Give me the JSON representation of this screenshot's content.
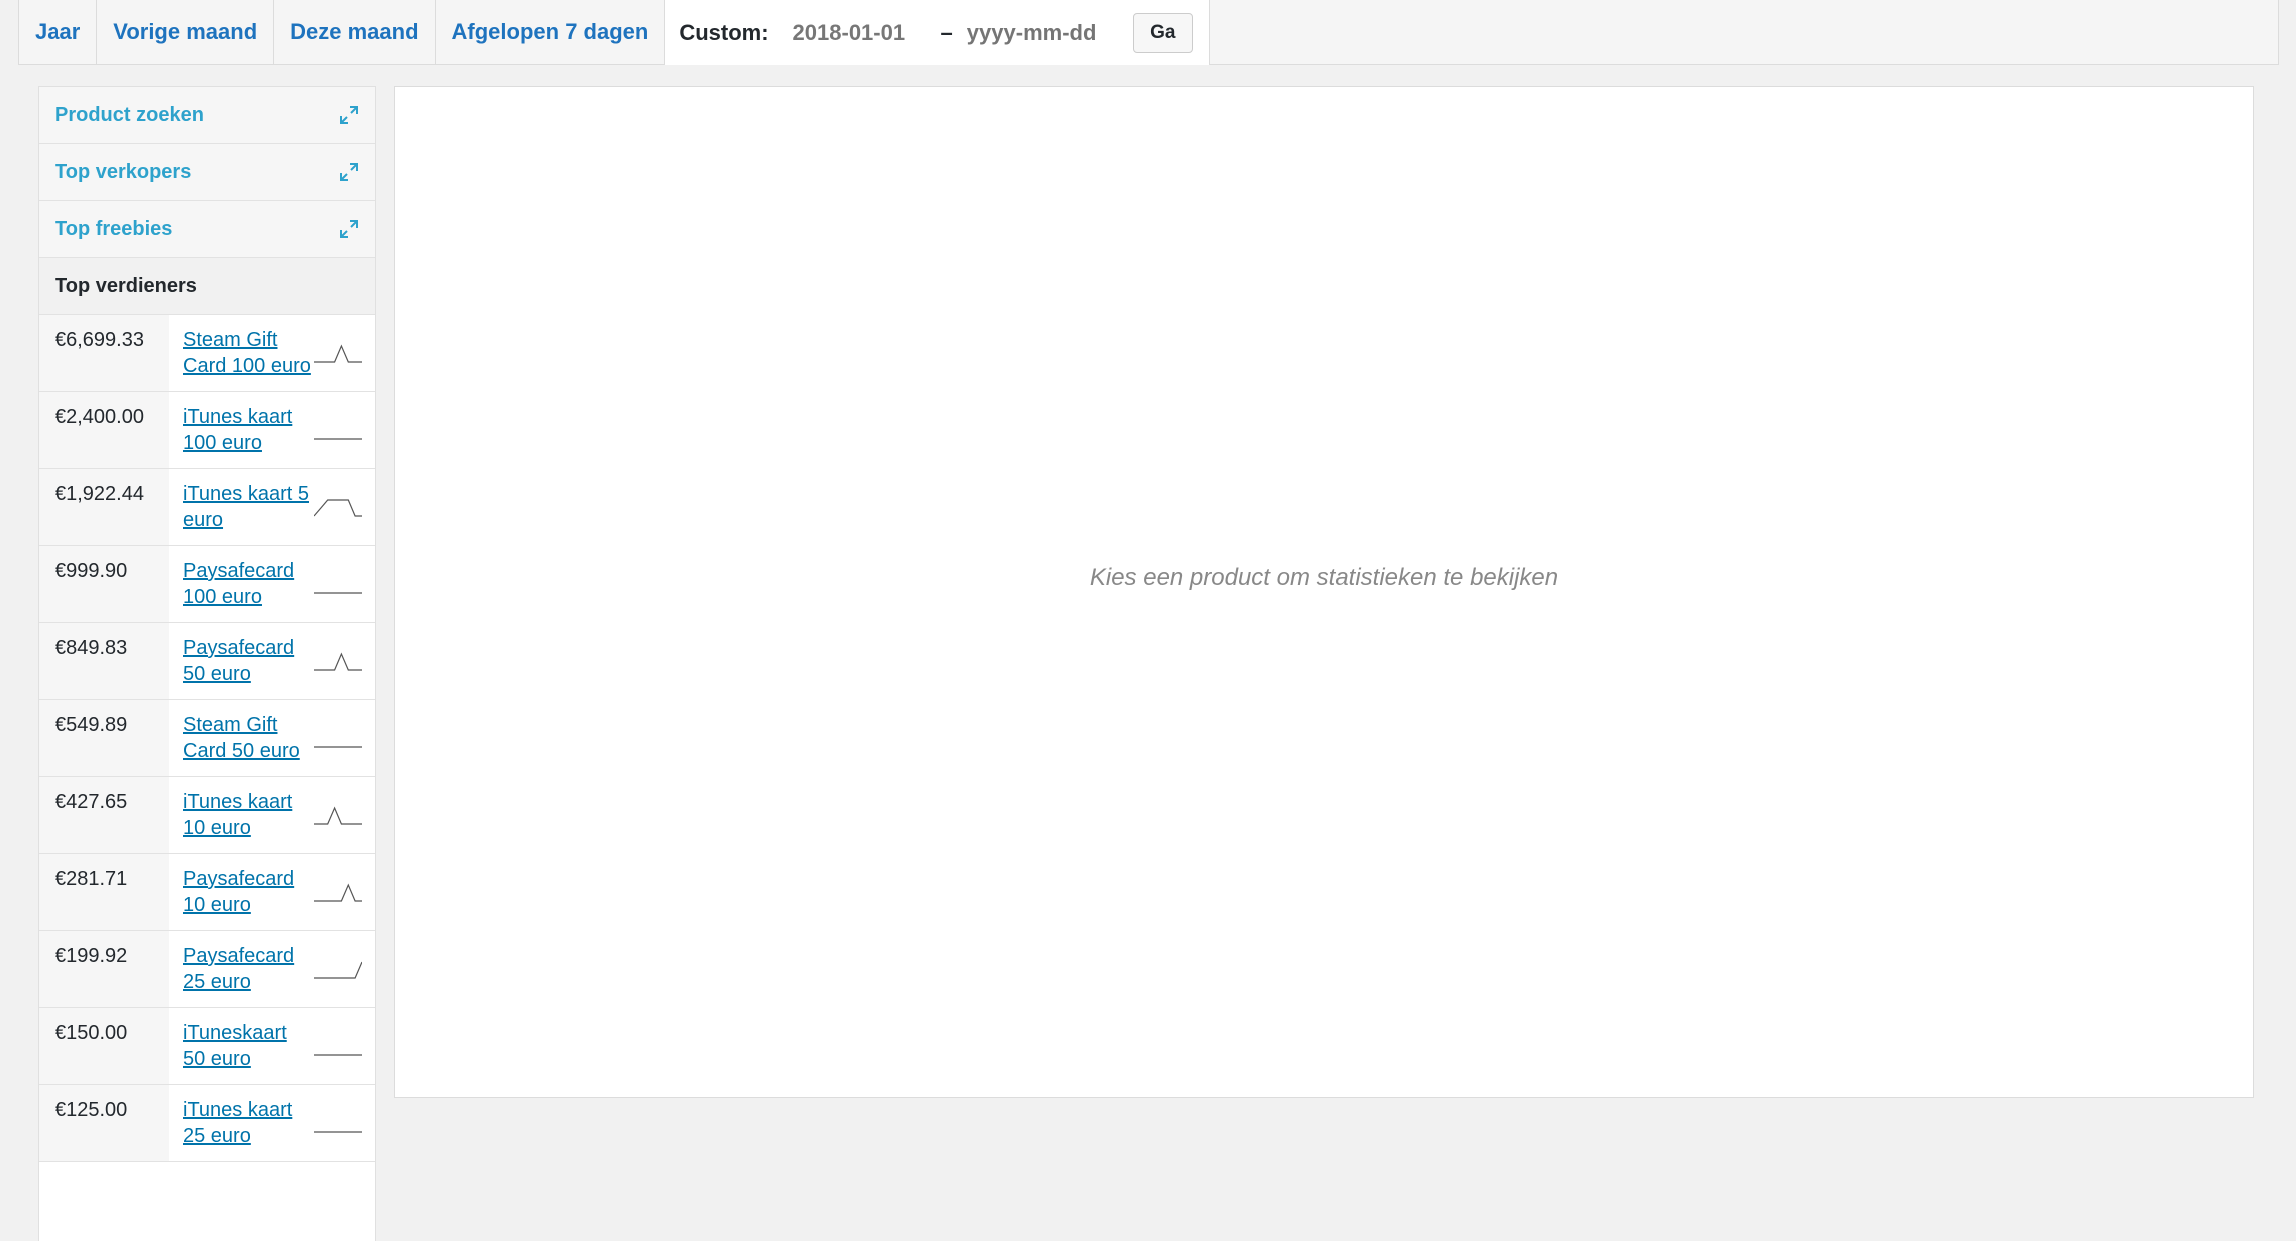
{
  "range_bar": {
    "tabs": [
      {
        "label": "Jaar"
      },
      {
        "label": "Vorige maand"
      },
      {
        "label": "Deze maand"
      },
      {
        "label": "Afgelopen 7 dagen"
      }
    ],
    "custom_label": "Custom:",
    "start_date_value": "2018-01-01",
    "end_date_placeholder": "yyyy-mm-dd",
    "separator": "–",
    "go_label": "Ga"
  },
  "sidebar": {
    "widgets": [
      {
        "title": "Product zoeken",
        "icon": "expand-icon"
      },
      {
        "title": "Top verkopers",
        "icon": "expand-icon"
      },
      {
        "title": "Top freebies",
        "icon": "expand-icon"
      }
    ],
    "active_widget": {
      "title": "Top verdieners"
    },
    "top_earners": [
      {
        "amount": "€6,699.33",
        "name": "Steam Gift Card 100 euro",
        "trend": [
          0,
          0,
          0,
          0,
          1,
          0,
          0,
          0
        ]
      },
      {
        "amount": "€2,400.00",
        "name": "iTunes kaart 100 euro",
        "trend": [
          0,
          0,
          0,
          0,
          0,
          0,
          0,
          0
        ]
      },
      {
        "amount": "€1,922.44",
        "name": "iTunes kaart 5 euro",
        "trend": [
          0,
          0.5,
          1,
          1,
          1,
          1,
          0,
          0
        ]
      },
      {
        "amount": "€999.90",
        "name": "Paysafecard 100 euro",
        "trend": [
          0,
          0,
          0,
          0,
          0,
          0,
          0,
          0
        ]
      },
      {
        "amount": "€849.83",
        "name": "Paysafecard 50 euro",
        "trend": [
          0,
          0,
          0,
          0,
          1,
          0,
          0,
          0
        ]
      },
      {
        "amount": "€549.89",
        "name": "Steam Gift Card 50 euro",
        "trend": [
          0,
          0,
          0,
          0,
          0,
          0,
          0,
          0
        ]
      },
      {
        "amount": "€427.65",
        "name": "iTunes kaart 10 euro",
        "trend": [
          0,
          0,
          0,
          1,
          0,
          0,
          0,
          0
        ]
      },
      {
        "amount": "€281.71",
        "name": "Paysafecard 10 euro",
        "trend": [
          0,
          0,
          0,
          0,
          0,
          1,
          0,
          0
        ]
      },
      {
        "amount": "€199.92",
        "name": "Paysafecard 25 euro",
        "trend": [
          0,
          0,
          0,
          0,
          0,
          0,
          0,
          1
        ]
      },
      {
        "amount": "€150.00",
        "name": "iTuneskaart 50 euro",
        "trend": [
          0,
          0,
          0,
          0,
          0,
          0,
          0,
          0
        ]
      },
      {
        "amount": "€125.00",
        "name": "iTunes kaart 25 euro",
        "trend": [
          0,
          0,
          0,
          0,
          0,
          0,
          0,
          0
        ]
      }
    ]
  },
  "main": {
    "placeholder": "Kies een product om statistieken te bekijken"
  },
  "colors": {
    "link": "#0073aa",
    "widget_title": "#2ea2cc",
    "tab_text": "#1e73be",
    "sparkline": "#555555"
  }
}
